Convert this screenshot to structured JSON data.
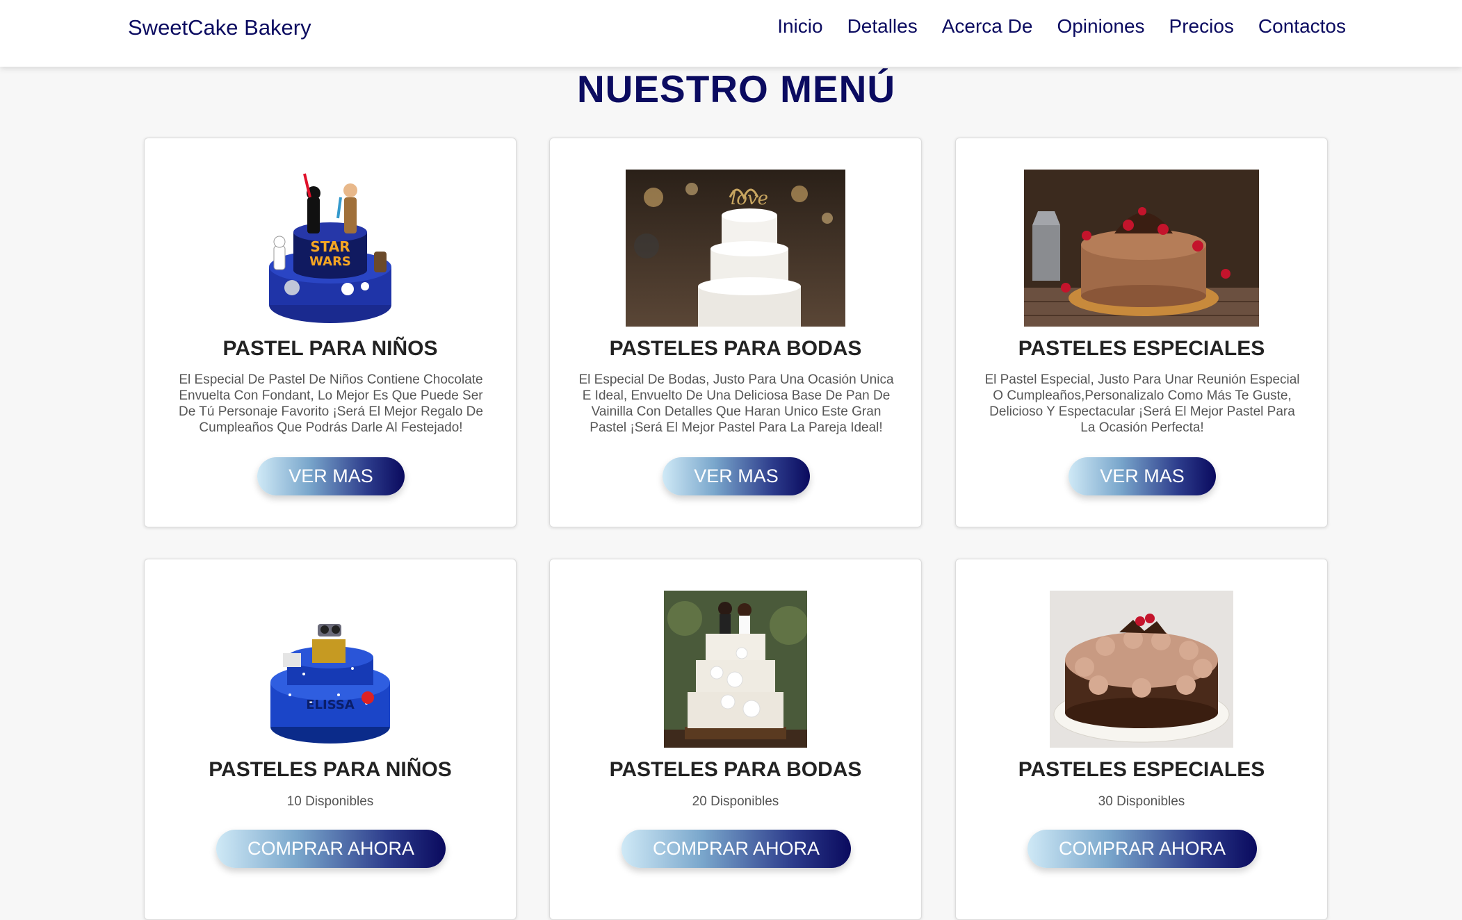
{
  "header": {
    "brand": "SweetCake Bakery",
    "nav": [
      "Inicio",
      "Detalles",
      "Acerca De",
      "Opiniones",
      "Precios",
      "Contactos"
    ]
  },
  "menu_title": "NUESTRO MENÚ",
  "cards_row1": [
    {
      "image": "star-wars-kids-cake",
      "title": "PASTEL PARA NIÑOS",
      "description": "El Especial De Pastel De Niños Contiene Chocolate Envuelta Con Fondant, Lo Mejor Es Que Puede Ser De Tú Personaje Favorito ¡Será El Mejor Regalo De Cumpleaños Que Podrás Darle Al Festejado!",
      "button": "VER MAS"
    },
    {
      "image": "wedding-love-cake",
      "title": "PASTELES PARA BODAS",
      "description": "El Especial De Bodas, Justo Para Una Ocasión Unica E Ideal, Envuelto De Una Deliciosa Base De Pan De Vainilla Con Detalles Que Haran Unico Este Gran Pastel ¡Será El Mejor Pastel Para La Pareja Ideal!",
      "button": "VER MAS"
    },
    {
      "image": "chocolate-raspberry-cake",
      "title": "PASTELES ESPECIALES",
      "description": "El Pastel Especial, Justo Para Unar Reunión Especial O Cumpleaños,Personalizalo Como Más Te Guste, Delicioso Y Espectacular ¡Será El Mejor Pastel Para La Ocasión Perfecta!",
      "button": "VER MAS"
    }
  ],
  "cards_row2": [
    {
      "image": "wall-e-kids-cake",
      "title": "PASTELES PARA NIÑOS",
      "availability": "10 Disponibles",
      "button": "COMPRAR AHORA"
    },
    {
      "image": "floral-wedding-cake",
      "title": "PASTELES PARA BODAS",
      "availability": "20 Disponibles",
      "button": "COMPRAR AHORA"
    },
    {
      "image": "chocolate-cream-cake",
      "title": "PASTELES ESPECIALES",
      "availability": "30 Disponibles",
      "button": "COMPRAR AHORA"
    }
  ],
  "colors": {
    "primary": "#0b0b60",
    "page_background": "#f7f7f7",
    "card_background": "#ffffff",
    "button_gradient_start": "#cfe9f6",
    "button_gradient_end": "#0a0a5e"
  }
}
